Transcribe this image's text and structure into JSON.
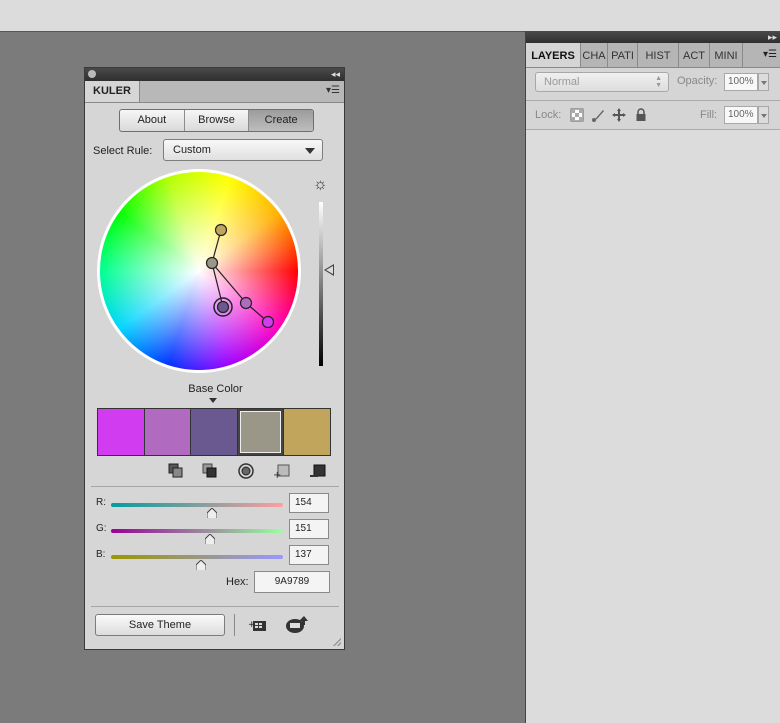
{
  "kuler": {
    "panel_title": "KULER",
    "modes": [
      "About",
      "Browse",
      "Create"
    ],
    "active_mode": "Create",
    "select_rule_label": "Select Rule:",
    "select_rule_value": "Custom",
    "base_color_label": "Base Color",
    "swatches": [
      "#d23cf0",
      "#b06ac0",
      "#6a5890",
      "#9a9789",
      "#c2a55c"
    ],
    "selected_swatch_index": 3,
    "sliders": {
      "r": {
        "label": "R:",
        "value": "154"
      },
      "g": {
        "label": "G:",
        "value": "151"
      },
      "b": {
        "label": "B:",
        "value": "137"
      }
    },
    "hex_label": "Hex:",
    "hex_value": "9A9789",
    "save_theme_label": "Save Theme"
  },
  "layers": {
    "tabs": [
      "LAYERS",
      "CHA",
      "PATI",
      "HIST",
      "ACT",
      "MINI"
    ],
    "active_tab": "LAYERS",
    "blend_mode": "Normal",
    "opacity_label": "Opacity:",
    "opacity_value": "100%",
    "lock_label": "Lock:",
    "fill_label": "Fill:",
    "fill_value": "100%"
  },
  "colors": {
    "workspace_bg": "#7b7b7b",
    "panel_bg": "#d6d6d6",
    "base_color": "#9A9789"
  }
}
